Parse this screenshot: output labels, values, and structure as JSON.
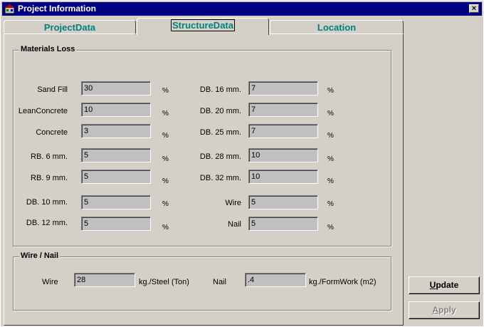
{
  "window": {
    "title": "Project Information",
    "close_glyph": "×"
  },
  "tabs": [
    {
      "label": "ProjectData"
    },
    {
      "label": "StructureData"
    },
    {
      "label": "Location"
    }
  ],
  "materials_loss": {
    "title": "Materials Loss",
    "left": [
      {
        "label": "Sand Fill",
        "value": "30",
        "unit": "%"
      },
      {
        "label": "LeanConcrete",
        "value": "10",
        "unit": "%"
      },
      {
        "label": "Concrete",
        "value": "3",
        "unit": "%"
      },
      {
        "label": "RB. 6 mm.",
        "value": "5",
        "unit": "%"
      },
      {
        "label": "RB. 9 mm.",
        "value": "5",
        "unit": "%"
      },
      {
        "label": "DB. 10 mm.",
        "value": "5",
        "unit": "%"
      },
      {
        "label": "DB. 12 mm.",
        "value": "5",
        "unit": "%"
      }
    ],
    "right": [
      {
        "label": "DB. 16 mm.",
        "value": "7",
        "unit": "%"
      },
      {
        "label": "DB. 20 mm.",
        "value": "7",
        "unit": "%"
      },
      {
        "label": "DB. 25 mm.",
        "value": "7",
        "unit": "%"
      },
      {
        "label": "DB. 28 mm.",
        "value": "10",
        "unit": "%"
      },
      {
        "label": "DB. 32 mm.",
        "value": "10",
        "unit": "%"
      },
      {
        "label": "Wire",
        "value": "5",
        "unit": "%"
      },
      {
        "label": "Nail",
        "value": "5",
        "unit": "%"
      }
    ]
  },
  "wire_nail": {
    "title": "Wire / Nail",
    "wire_label": "Wire",
    "wire_value": "28",
    "wire_unit": "kg./Steel (Ton)",
    "nail_label": "Nail",
    "nail_value": ".4",
    "nail_unit": "kg./FormWork (m2)"
  },
  "buttons": {
    "update_first": "U",
    "update_rest": "pdate",
    "apply_first": "A",
    "apply_rest": "pply"
  }
}
